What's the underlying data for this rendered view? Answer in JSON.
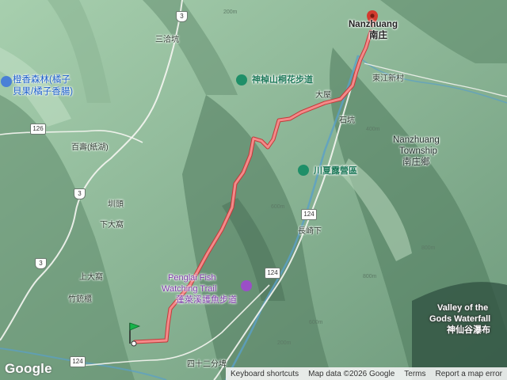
{
  "map": {
    "labels": {
      "nanzhuang_en": "Nanzhuang",
      "nanzhuang_zh": "南庄",
      "sanqiaokeng": "三洽坑",
      "chengxiang_forest_line1": "橙香森林(橘子",
      "chengxiang_forest_line2": "貝果/橘子香腸)",
      "shenzhangshan_trail": "神棹山桐花步道",
      "dalong": "大屋",
      "dongjiang_village": "東江新村",
      "shikeng": "石坑",
      "township_en_1": "Nanzhuang",
      "township_en_2": "Township",
      "township_zh": "南庄鄉",
      "baishou": "百壽(紙湖)",
      "chuanxia_camp": "川夏露營區",
      "kanbei": "圳頭",
      "xiadawo": "下大窩",
      "changqi_xia": "長崎下",
      "shangdawo": "上大窩",
      "penglai_fish_en_1": "Penglai Fish",
      "penglai_fish_en_2": "Watching Trail",
      "penglai_fish_zh": "蓬萊溪護魚步道",
      "zhuchong": "竹銃櫃",
      "valley_gods_1": "Valley of the",
      "valley_gods_2": "Gods Waterfall",
      "valley_gods_zh": "神仙谷瀑布",
      "sishier_fen": "四十二分埤"
    },
    "contours": [
      "200m",
      "400m",
      "600m",
      "800m",
      "400m",
      "600m",
      "800m",
      "200m"
    ],
    "shields": {
      "r3_top": "3",
      "r3_mid": "3",
      "r3_low": "3",
      "r126": "126",
      "r124_a": "124",
      "r124_b": "124",
      "r124_c": "124"
    },
    "icons": {
      "destination": "red-pin-icon",
      "start": "green-flag-icon",
      "trail": "hiking-trail-icon",
      "camp": "campground-icon",
      "photo": "attraction-icon"
    },
    "colors": {
      "route": "#f26b6b",
      "route_outline": "#c23a3a",
      "terrain": "#7fa98a",
      "water": "#5aa0c8"
    }
  },
  "footer": {
    "logo": "Google",
    "shortcuts": "Keyboard shortcuts",
    "map_data": "Map data ©2026 Google",
    "terms": "Terms",
    "report": "Report a map error"
  }
}
